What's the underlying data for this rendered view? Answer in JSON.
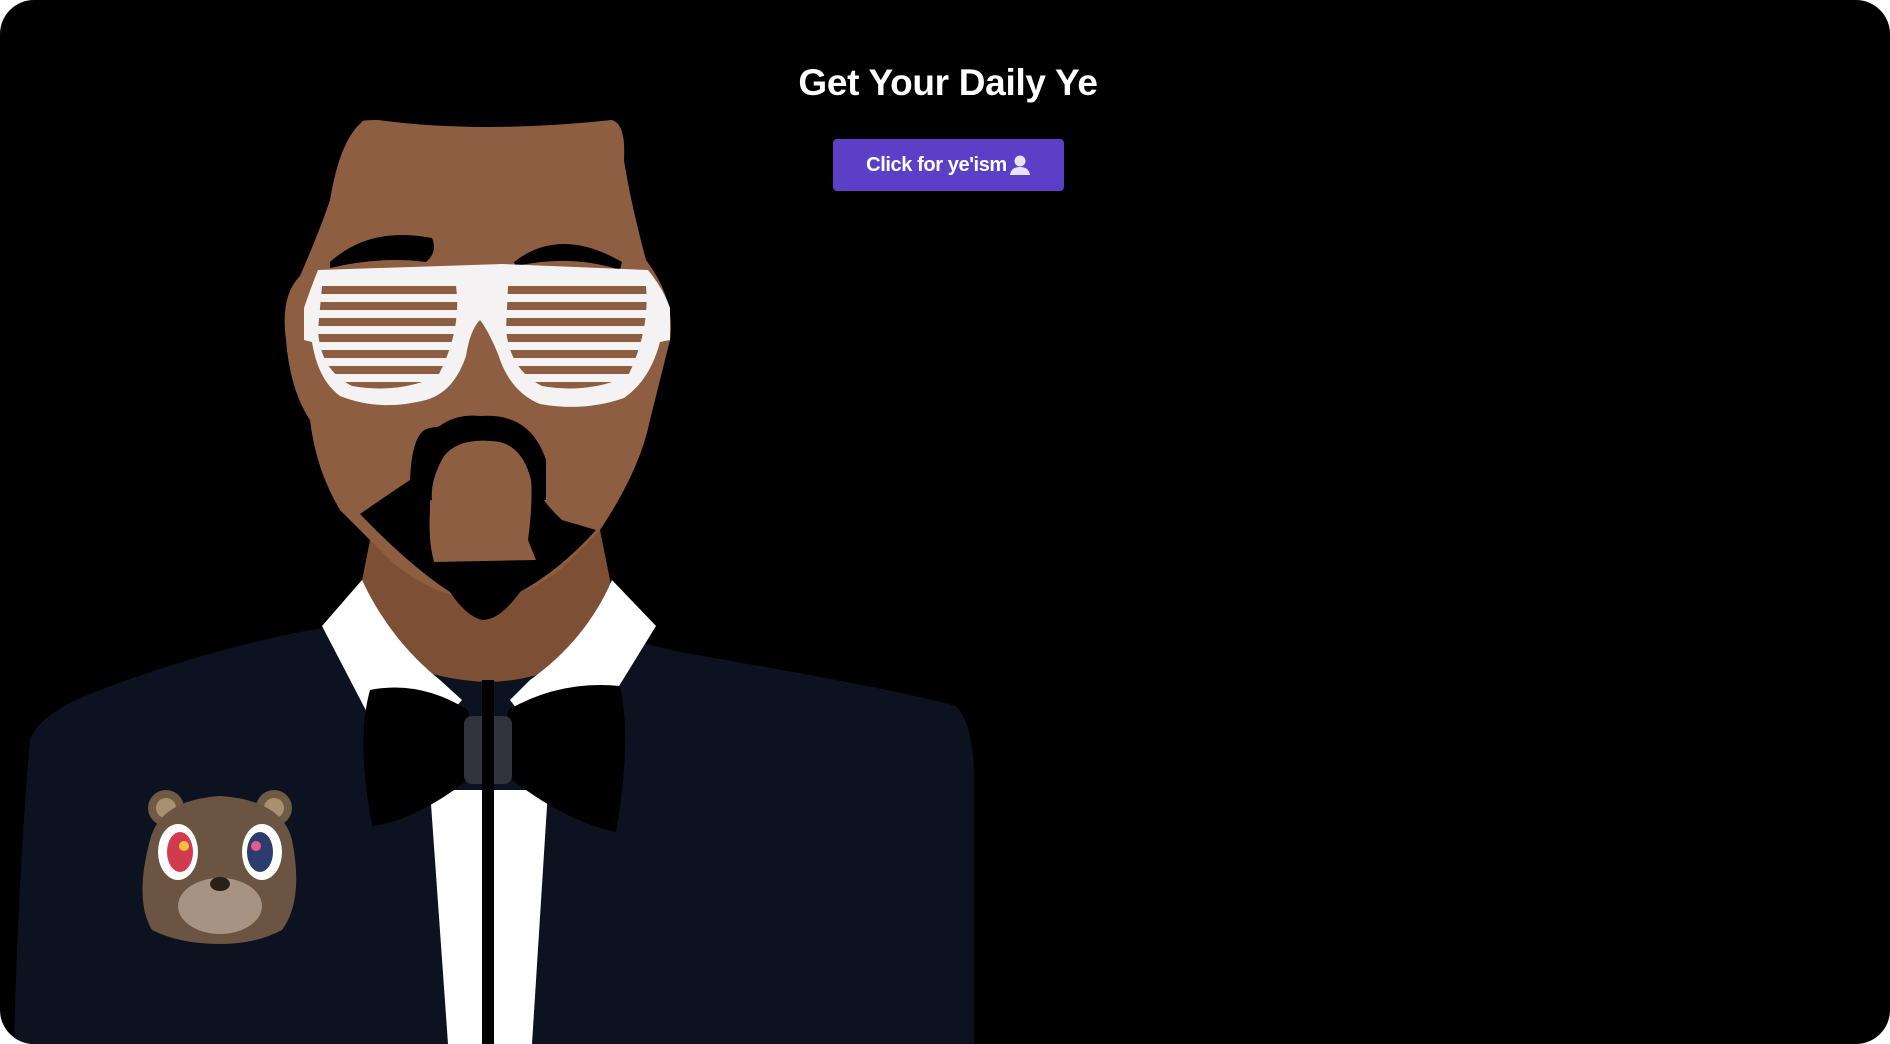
{
  "page": {
    "title": "Get Your Daily Ye",
    "button_label": "Click for ye'ism",
    "button_icon": "person-icon"
  },
  "colors": {
    "background": "#000000",
    "button": "#5b3fc6",
    "text": "#ffffff",
    "skin": "#8d5e42",
    "jacket": "#0c1220"
  }
}
